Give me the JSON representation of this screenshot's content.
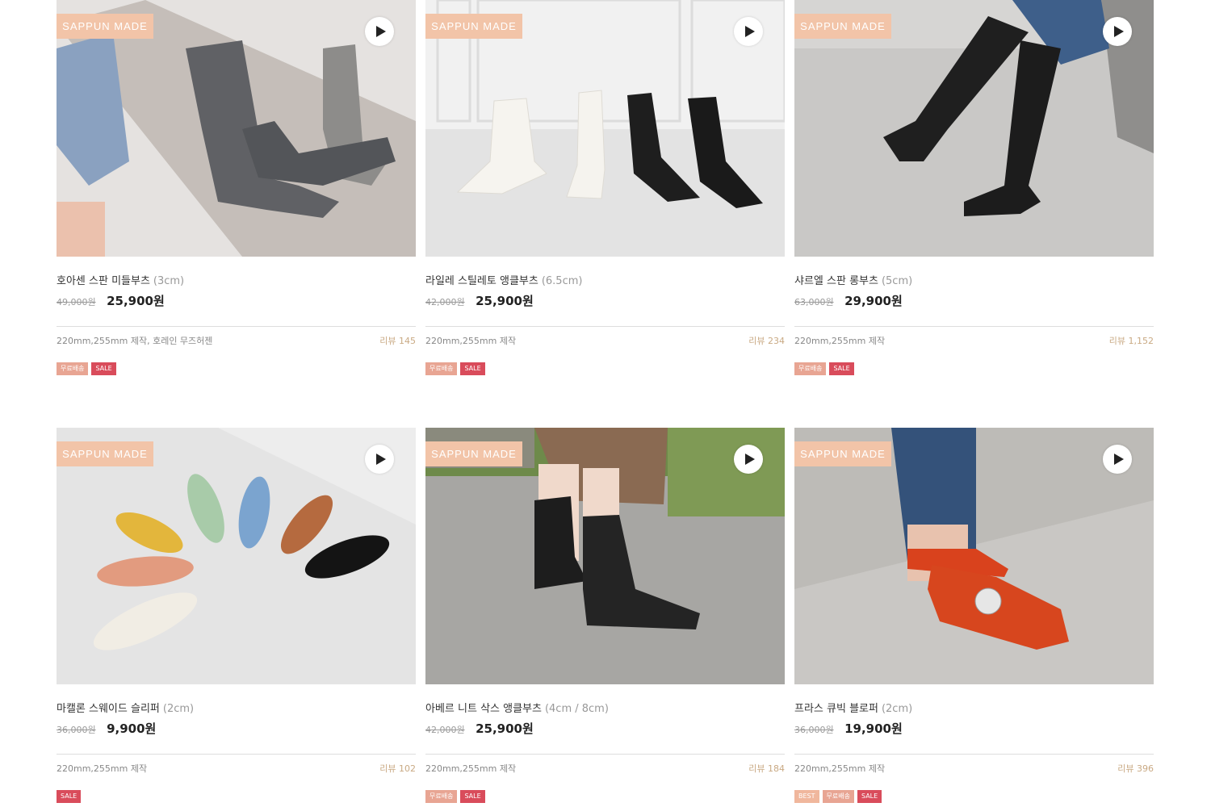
{
  "badge_text": "SAPPUN MADE",
  "colors": {
    "badge": "#f2c4a8",
    "sale_tag": "#d94c5b",
    "free_tag": "#e8a593",
    "best_tag": "#f0b79d",
    "review": "#c9a983"
  },
  "icons": {
    "play": "play-icon"
  },
  "products": [
    {
      "name": "호아센 스판 미들부츠",
      "size": "(3cm)",
      "original_price": "49,000원",
      "price": "25,900원",
      "note": "220mm,255mm 제작, 호레인 무즈허젠",
      "reviews": "리뷰 145",
      "tags": [
        "무료배송",
        "SALE"
      ]
    },
    {
      "name": "라일레 스틸레토 앵클부츠",
      "size": "(6.5cm)",
      "original_price": "42,000원",
      "price": "25,900원",
      "note": "220mm,255mm 제작",
      "reviews": "리뷰 234",
      "tags": [
        "무료배송",
        "SALE"
      ]
    },
    {
      "name": "샤르엘 스판 롱부츠",
      "size": "(5cm)",
      "original_price": "63,000원",
      "price": "29,900원",
      "note": "220mm,255mm 제작",
      "reviews": "리뷰 1,152",
      "tags": [
        "무료배송",
        "SALE"
      ]
    },
    {
      "name": "마캘론 스웨이드 슬리퍼",
      "size": "(2cm)",
      "original_price": "36,000원",
      "price": "9,900원",
      "note": "220mm,255mm 제작",
      "reviews": "리뷰 102",
      "tags": [
        "SALE"
      ]
    },
    {
      "name": "아베르 니트 삭스 앵클부츠",
      "size": "(4cm / 8cm)",
      "original_price": "42,000원",
      "price": "25,900원",
      "note": "220mm,255mm 제작",
      "reviews": "리뷰 184",
      "tags": [
        "무료배송",
        "SALE"
      ]
    },
    {
      "name": "프라스 큐빅 블로퍼",
      "size": "(2cm)",
      "original_price": "36,000원",
      "price": "19,900원",
      "note": "220mm,255mm 제작",
      "reviews": "리뷰 396",
      "tags": [
        "BEST",
        "무료배송",
        "SALE"
      ]
    }
  ]
}
